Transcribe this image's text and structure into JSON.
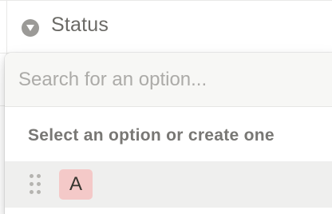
{
  "header": {
    "property_name": "Status",
    "property_icon": "chevron-circle-down-icon"
  },
  "popup": {
    "search": {
      "value": "",
      "placeholder": "Search for an option..."
    },
    "hint": "Select an option or create one",
    "options": [
      {
        "label": "A",
        "color": "#f4c9c8",
        "drag_icon": "drag-handle-icon"
      }
    ]
  },
  "colors": {
    "grid_line": "#e9e9e7",
    "header_text": "#6b6a66",
    "header_icon_bg": "#9b9a97",
    "search_bg": "#f7f7f5",
    "hover_row_bg": "#efefee",
    "hint_text": "#787774"
  }
}
